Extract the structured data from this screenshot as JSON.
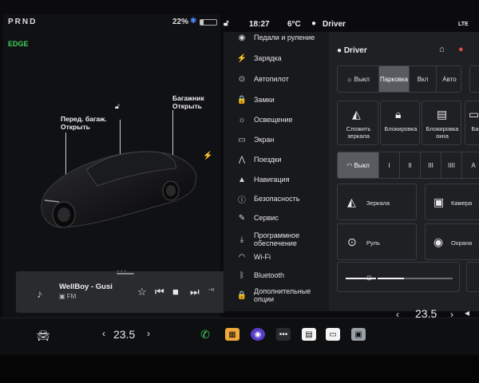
{
  "status_left": {
    "gear": "PRND",
    "battery": "22%",
    "lights_indicator": "EDGE"
  },
  "status_right": {
    "time": "18:27",
    "temperature": "6°C",
    "profile": "Driver",
    "network": "LTE"
  },
  "car_view": {
    "frunk_label": "Перед. багаж.\nОткрыть",
    "trunk_label": "Багажник\nОткрыть",
    "page_dots": "•••"
  },
  "media": {
    "title": "WellBoy - Gusi",
    "source": "FM"
  },
  "menu": [
    {
      "icon": "steering-wheel-icon",
      "glyph": "◉",
      "label": "Педали и руление"
    },
    {
      "icon": "lightning-icon",
      "glyph": "⚡",
      "label": "Зарядка"
    },
    {
      "icon": "steering-wheel-icon",
      "glyph": "⊙",
      "label": "Автопилот"
    },
    {
      "icon": "lock-icon",
      "glyph": "🔒",
      "label": "Замки"
    },
    {
      "icon": "sun-icon",
      "glyph": "☼",
      "label": "Освещение"
    },
    {
      "icon": "screen-icon",
      "glyph": "▭",
      "label": "Экран"
    },
    {
      "icon": "road-icon",
      "glyph": "⋀",
      "label": "Поездки"
    },
    {
      "icon": "navigation-icon",
      "glyph": "▲",
      "label": "Навигация"
    },
    {
      "icon": "safety-icon",
      "glyph": "ⓘ",
      "label": "Безопасность"
    },
    {
      "icon": "wrench-icon",
      "glyph": "✎",
      "label": "Сервис"
    },
    {
      "icon": "download-icon",
      "glyph": "⤓",
      "label": "Программное обеспечение"
    },
    {
      "icon": "wifi-icon",
      "glyph": "◠",
      "label": "Wi-Fi"
    },
    {
      "icon": "bluetooth-icon",
      "glyph": "ᛒ",
      "label": "Bluetooth"
    },
    {
      "icon": "lock-icon",
      "glyph": "🔒",
      "label": "Дополнительные опции"
    }
  ],
  "pane": {
    "driver": "Driver",
    "headlights": {
      "options": [
        "Выкл",
        "Парковка",
        "Вкл",
        "Авто"
      ],
      "selected": "Парковка"
    },
    "quick_tiles": [
      {
        "icon": "mirror-icon",
        "label": "Сложить зеркала"
      },
      {
        "icon": "child-lock-icon",
        "label": "Блокировка"
      },
      {
        "icon": "window-lock-icon",
        "label": "Блокировка окна"
      },
      {
        "icon": "glovebox-icon",
        "label": "Ба"
      }
    ],
    "wipers": {
      "options": [
        "Выкл",
        "I",
        "II",
        "III",
        "IIII",
        "А"
      ],
      "selected": "Выкл"
    },
    "adjust_tiles": [
      {
        "icon": "mirror-adjust-icon",
        "label": "Зеркала"
      },
      {
        "icon": "steering-adjust-icon",
        "label": "Руль"
      },
      {
        "icon": "dashcam-icon",
        "label": "Камера"
      },
      {
        "icon": "sentry-icon",
        "label": "Охрана"
      }
    ],
    "brightness_level": 0.35
  },
  "bottom": {
    "temp_left": "23.5",
    "temp_right": "23.5"
  }
}
